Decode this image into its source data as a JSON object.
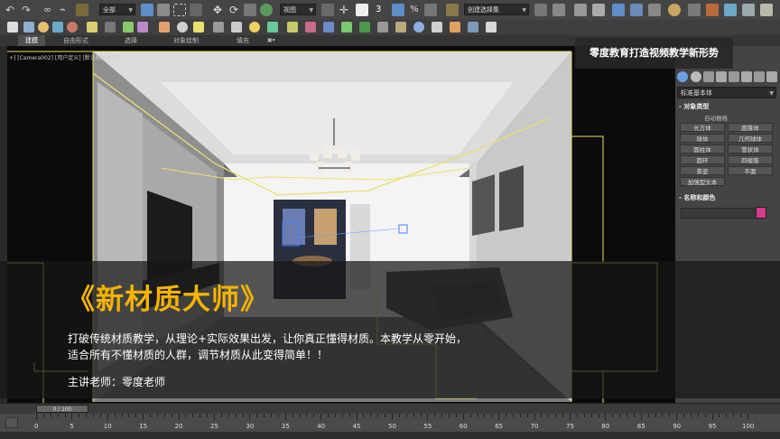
{
  "toolbar": {
    "selection_filter": "全部",
    "view_dropdown": "视图",
    "snap_label": "3",
    "named_selection": "创建选择集"
  },
  "ribbon": {
    "tabs": [
      "建模",
      "自由形式",
      "选择",
      "对象绘制",
      "填充"
    ]
  },
  "viewport": {
    "label": "+] [Camera002] [用户定义] [默认明暗处理]"
  },
  "watermark": "零度教育打造视频教学新形势",
  "command_panel": {
    "category_dropdown": "标准基本体",
    "section_object_type": "对象类型",
    "autogrid": "自动栅格",
    "buttons": [
      "长方体",
      "圆锥体",
      "球体",
      "几何球体",
      "圆柱体",
      "管状体",
      "圆环",
      "四棱锥",
      "茶壶",
      "平面"
    ],
    "extended_button": "加强型文本",
    "section_name_color": "名称和颜色",
    "object_color": "#d63b8c"
  },
  "banner": {
    "title": "《新材质大师》",
    "description": "打破传统材质教学，从理论+实际效果出发，让你真正懂得材质。本教学从零开始，适合所有不懂材质的人群，调节材质从此变得简单！！",
    "teacher": "主讲老师：零度老师"
  },
  "timeline": {
    "frame_display": "0 / 100",
    "ticks": [
      "0",
      "5",
      "10",
      "15",
      "20",
      "25",
      "30",
      "35",
      "40",
      "45",
      "50",
      "55",
      "60",
      "65",
      "70",
      "75",
      "80",
      "85",
      "90",
      "95",
      "100"
    ]
  },
  "colors": {
    "title_accent": "#f5b400",
    "toolbar_bg": "#454545",
    "viewport_frame": "#e8e070"
  }
}
